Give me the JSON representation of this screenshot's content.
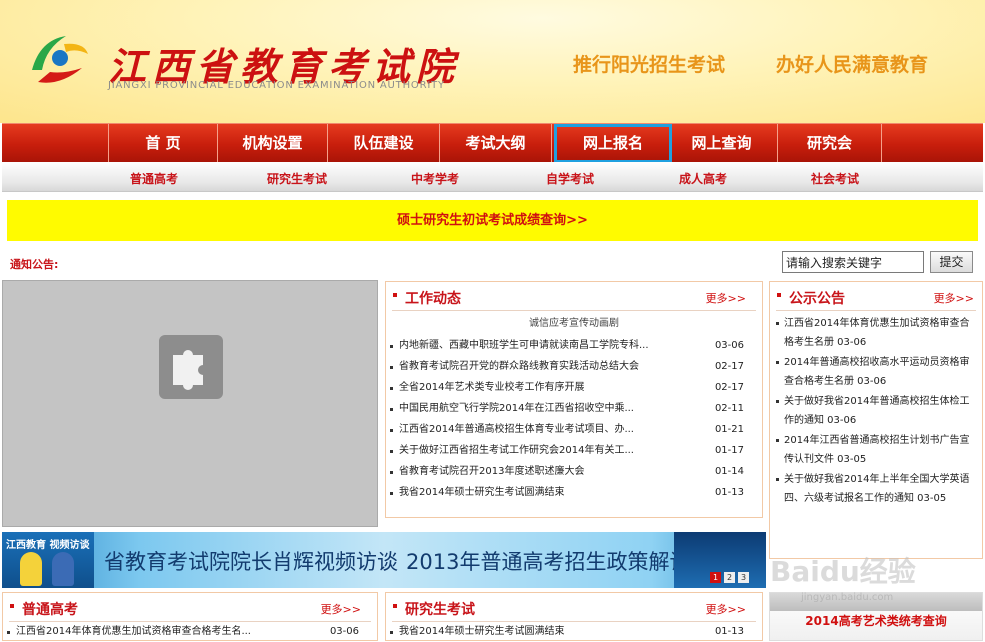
{
  "header": {
    "title": "江西省教育考试院",
    "subtitle": "JIANGXI PROVINCIAL EDUCATION EXAMINATION AUTHORITY",
    "slogan_left": "推行阳光招生考试",
    "slogan_right": "办好人民满意教育"
  },
  "main_nav": [
    "首 页",
    "机构设置",
    "队伍建设",
    "考试大纲",
    "网上报名",
    "网上查询",
    "研究会"
  ],
  "sub_nav": [
    "普通高考",
    "研究生考试",
    "中考学考",
    "自学考试",
    "成人高考",
    "社会考试"
  ],
  "yellow_banner": "硕士研究生初试考试成绩查询>>",
  "notice_label": "通知公告:",
  "search": {
    "value": "请输入搜索关键字",
    "button": "提交"
  },
  "work_news": {
    "title": "工作动态",
    "more": "更多>>",
    "headline": "诚信应考宣传动画剧",
    "items": [
      {
        "t": "内地新疆、西藏中职班学生可申请就读南昌工学院专科...",
        "d": "03-06"
      },
      {
        "t": "省教育考试院召开党的群众路线教育实践活动总结大会",
        "d": "02-17"
      },
      {
        "t": "全省2014年艺术类专业校考工作有序开展",
        "d": "02-17"
      },
      {
        "t": "中国民用航空飞行学院2014年在江西省招收空中乘...",
        "d": "02-11"
      },
      {
        "t": "江西省2014年普通高校招生体育专业考试项目、办...",
        "d": "01-21"
      },
      {
        "t": "关于做好江西省招生考试工作研究会2014年有关工...",
        "d": "01-17"
      },
      {
        "t": "省教育考试院召开2013年度述职述廉大会",
        "d": "01-14"
      },
      {
        "t": "我省2014年硕士研究生考试圆满结束",
        "d": "01-13"
      }
    ]
  },
  "public_notice": {
    "title": "公示公告",
    "more": "更多>>",
    "items": [
      "江西省2014年体育优惠生加试资格审查合格考生名册 03-06",
      "2014年普通高校招收高水平运动员资格审查合格考生名册 03-06",
      "关于做好我省2014年普通高校招生体检工作的通知 03-06",
      "2014年江西省普通高校招生计划书广告宣传认刊文件 03-05",
      "关于做好我省2014年上半年全国大学英语四、六级考试报名工作的通知 03-05"
    ]
  },
  "wide_banner": {
    "left_label": "江西教育 视频访谈",
    "text_1": "省教育考试院院长肖辉视频访谈",
    "text_2": "2013年普通高考招生政策解读",
    "pages": [
      "1",
      "2",
      "3"
    ]
  },
  "gaokao": {
    "title": "普通高考",
    "more": "更多>>",
    "items": [
      {
        "t": "江西省2014年体育优惠生加试资格审查合格考生名...",
        "d": "03-06"
      }
    ]
  },
  "graduate": {
    "title": "研究生考试",
    "more": "更多>>",
    "items": [
      {
        "t": "我省2014年硕士研究生考试圆满结束",
        "d": "01-13"
      }
    ]
  },
  "art_banner": "2014高考艺术类统考查询",
  "watermark": {
    "text": "Baidu经验",
    "url": "jingyan.baidu.com"
  },
  "colors": {
    "nav_red": "#c81e0c",
    "title_red": "#c8141a",
    "active_blue": "#1fa0e0",
    "banner_yellow": "#fffb00"
  }
}
